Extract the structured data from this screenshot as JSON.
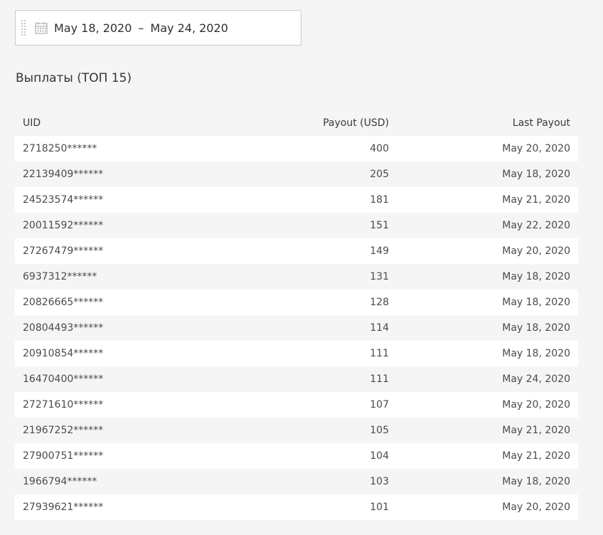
{
  "date_range": {
    "start": "May 18, 2020",
    "separator": "–",
    "end": "May 24, 2020",
    "icon": "calendar-icon"
  },
  "section": {
    "title": "Выплаты (ТОП 15)"
  },
  "table": {
    "headers": {
      "uid": "UID",
      "payout": "Payout (USD)",
      "last_payout": "Last Payout"
    },
    "rows": [
      {
        "uid": "2718250******",
        "payout": "400",
        "last": "May 20, 2020"
      },
      {
        "uid": "22139409******",
        "payout": "205",
        "last": "May 18, 2020"
      },
      {
        "uid": "24523574******",
        "payout": "181",
        "last": "May 21, 2020"
      },
      {
        "uid": "20011592******",
        "payout": "151",
        "last": "May 22, 2020"
      },
      {
        "uid": "27267479******",
        "payout": "149",
        "last": "May 20, 2020"
      },
      {
        "uid": "6937312******",
        "payout": "131",
        "last": "May 18, 2020"
      },
      {
        "uid": "20826665******",
        "payout": "128",
        "last": "May 18, 2020"
      },
      {
        "uid": "20804493******",
        "payout": "114",
        "last": "May 18, 2020"
      },
      {
        "uid": "20910854******",
        "payout": "111",
        "last": "May 18, 2020"
      },
      {
        "uid": "16470400******",
        "payout": "111",
        "last": "May 24, 2020"
      },
      {
        "uid": "27271610******",
        "payout": "107",
        "last": "May 20, 2020"
      },
      {
        "uid": "21967252******",
        "payout": "105",
        "last": "May 21, 2020"
      },
      {
        "uid": "27900751******",
        "payout": "104",
        "last": "May 21, 2020"
      },
      {
        "uid": "1966794******",
        "payout": "103",
        "last": "May 18, 2020"
      },
      {
        "uid": "27939621******",
        "payout": "101",
        "last": "May 20, 2020"
      }
    ]
  }
}
